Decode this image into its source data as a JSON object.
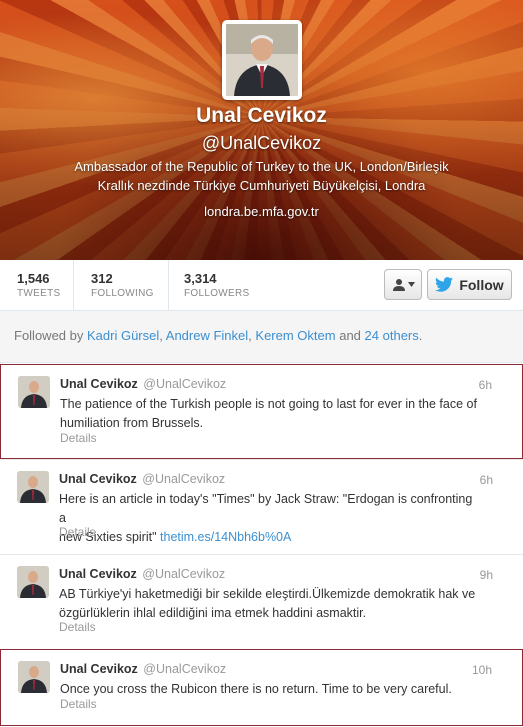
{
  "profile": {
    "name": "Unal Cevikoz",
    "handle": "@UnalCevikoz",
    "bio_line1": "Ambassador of the Republic of Turkey to the UK, London/Birleşik",
    "bio_line2": "Krallık nezdinde Türkiye Cumhuriyeti Büyükelçisi, Londra",
    "url": "londra.be.mfa.gov.tr"
  },
  "stats": [
    {
      "value": "1,546",
      "label": "TWEETS"
    },
    {
      "value": "312",
      "label": "FOLLOWING"
    },
    {
      "value": "3,314",
      "label": "FOLLOWERS"
    }
  ],
  "actions": {
    "follow_label": "Follow"
  },
  "followed_by": {
    "prefix": "Followed by",
    "user1": "Kadri Gürsel",
    "sep1": ",",
    "user2": "Andrew Finkel",
    "sep2": ",",
    "user3": "Kerem Oktem",
    "and": "and",
    "others": "24 others",
    "suffix": "."
  },
  "tweets": [
    {
      "name": "Unal Cevikoz",
      "handle": "@UnalCevikoz",
      "time": "6h",
      "line1": "The patience of the Turkish people is not going to last for ever in the face of",
      "line2": "humiliation from Brussels.",
      "details": "Details"
    },
    {
      "name": "Unal Cevikoz",
      "handle": "@UnalCevikoz",
      "time": "6h",
      "line1": "Here is an article in today's \"Times\" by Jack Straw: \"Erdogan is confronting a",
      "line2": "new Sixties spirit\"",
      "link": "thetim.es/14Nbh6b%0A",
      "details": "Details"
    },
    {
      "name": "Unal Cevikoz",
      "handle": "@UnalCevikoz",
      "time": "9h",
      "line1": "AB Türkiye'yi haketmediği bir sekilde eleştirdi.Ülkemizde demokratik hak ve",
      "line2": "özgürlüklerin ihlal edildiğini ima etmek haddini asmaktir.",
      "details": "Details"
    },
    {
      "name": "Unal Cevikoz",
      "handle": "@UnalCevikoz",
      "time": "10h",
      "line1": "Once you cross the Rubicon there is no return. Time to be very careful.",
      "details": "Details"
    }
  ],
  "colors": {
    "link": "#3b8fd0",
    "twitter_bird": "#2fa4e7",
    "selected_border": "#8b2a36"
  },
  "icons": [
    "user-dropdown-icon",
    "twitter-bird-icon",
    "chevron-down-icon"
  ]
}
